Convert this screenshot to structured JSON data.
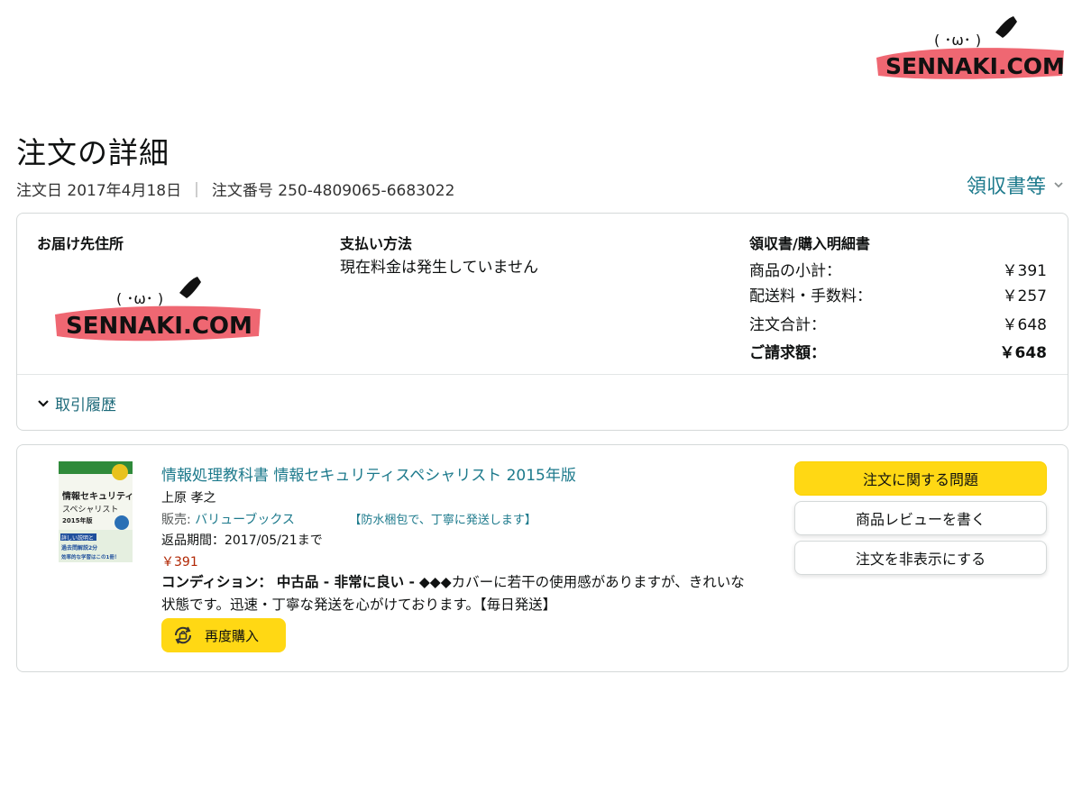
{
  "watermark": {
    "text": "SENNAKI.COM",
    "face": "( ･ω･ )"
  },
  "page": {
    "title": "注文の詳細",
    "order_date": "注文日 2017年4月18日",
    "separator": "|",
    "order_number": "注文番号 250-4809065-6683022",
    "receipt_link": "領収書等"
  },
  "summary": {
    "address_title": "お届け先住所",
    "payment_title": "支払い方法",
    "payment_text": "現在料金は発生していません",
    "receipt_title": "領収書/購入明細書",
    "rows": [
      {
        "label": "商品の小計：",
        "value": "￥391"
      },
      {
        "label": "配送料・手数料：",
        "value": "￥257"
      },
      {
        "label": "注文合計：",
        "value": "￥648"
      },
      {
        "label": "ご請求額：",
        "value": "￥648"
      }
    ],
    "history_label": "取引履歴"
  },
  "item": {
    "title": "情報処理教科書 情報セキュリティスペシャリスト 2015年版",
    "author": "上原 孝之",
    "seller_label": "販売:",
    "seller_name": "バリューブックス",
    "seller_note": "【防水梱包で、丁寧に発送します】",
    "return_period": "返品期間：2017/05/21まで",
    "price": "￥391",
    "condition_label": "コンディション：",
    "condition_value": "中古品 - 非常に良い -",
    "condition_note": "◆◆◆カバーに若干の使用感がありますが、きれいな状態です。迅速・丁寧な発送を心がけております。【毎日発送】",
    "rebuy_label": "再度購入",
    "cover": {
      "title_line1": "情報セキュリティ",
      "title_line2": "スペシャリスト",
      "year": "2015年版",
      "band_line1": "詳しい説明と",
      "band_line2": "過去問解説2分",
      "band_line3": "効率的な学習はこの1冊！"
    }
  },
  "actions": {
    "problem": "注文に関する問題",
    "review": "商品レビューを書く",
    "hide": "注文を非表示にする"
  },
  "colors": {
    "link": "#1d7a8c",
    "button_yellow": "#ffd814",
    "price_red": "#b12704",
    "border": "#d5d9d9",
    "watermark_pink": "#ee5a66"
  }
}
